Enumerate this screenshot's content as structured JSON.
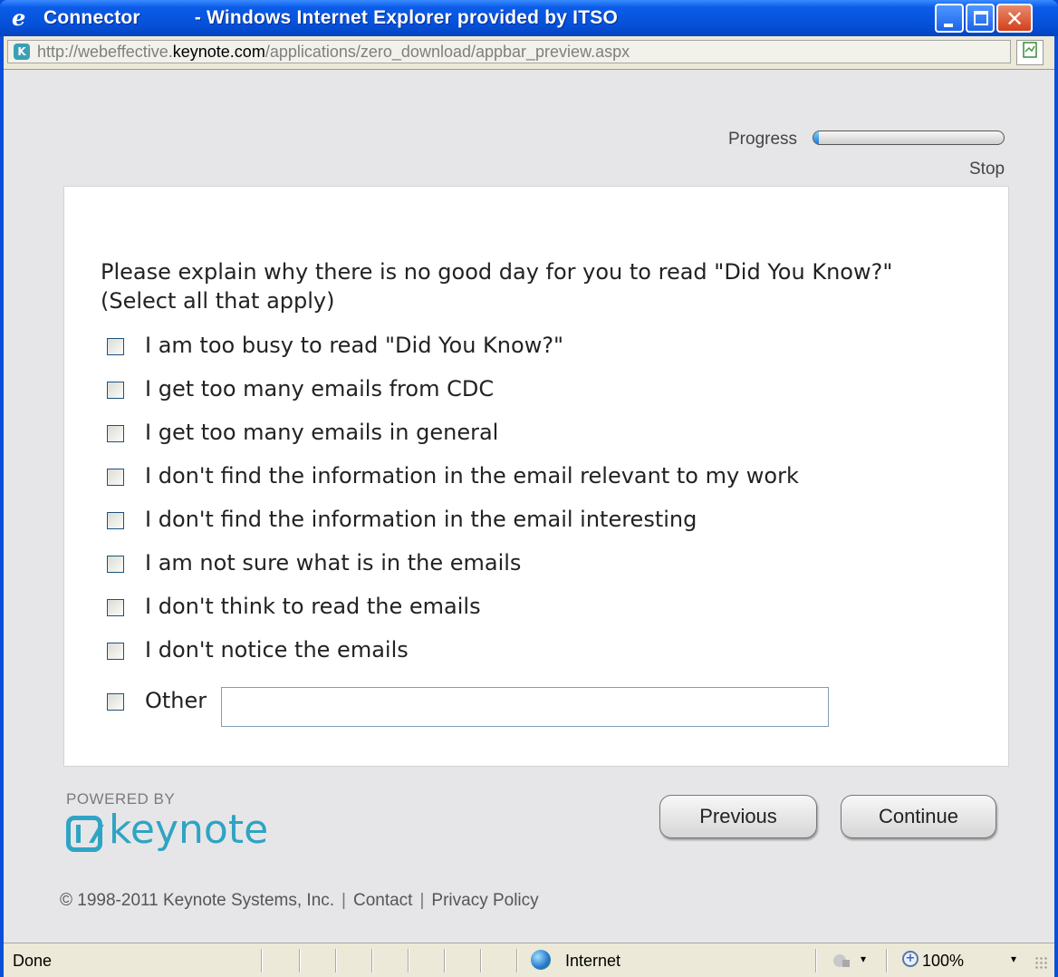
{
  "window": {
    "app_name": "Connector",
    "title_rest": "- Windows Internet Explorer provided by ITSO",
    "ie_icon": "ie-logo-icon",
    "minimize_icon": "minimize-icon",
    "maximize_icon": "maximize-icon",
    "close_icon": "close-icon",
    "close_glyph": "✕"
  },
  "address_bar": {
    "url_prefix": "http://webeffective.",
    "url_host": "keynote.com",
    "url_path": "/applications/zero_download/appbar_preview.aspx",
    "site_icon": "keynote-site-icon",
    "site_glyph": "K"
  },
  "survey": {
    "progress_label": "Progress",
    "progress_fraction": 0.03,
    "stop_label": "Stop",
    "question": "Please explain why there is no good day for you to read \"Did You Know?\" (Select all that apply)",
    "options": [
      {
        "label": "I am too busy to read \"Did You Know?\"",
        "checked": false
      },
      {
        "label": "I get too many emails from CDC",
        "checked": false
      },
      {
        "label": "I get too many emails in general",
        "checked": false
      },
      {
        "label": "I don't find the information in the email relevant to my work",
        "checked": false
      },
      {
        "label": "I don't find the information in the email interesting",
        "checked": false
      },
      {
        "label": "I am not sure what is in the emails",
        "checked": false
      },
      {
        "label": "I don't think to read the emails",
        "checked": false
      },
      {
        "label": "I don't notice the emails",
        "checked": false
      }
    ],
    "other": {
      "label": "Other",
      "value": "",
      "checked": false
    },
    "previous_label": "Previous",
    "continue_label": "Continue"
  },
  "branding": {
    "powered_by": "POWERED BY",
    "logo_text": "keynote",
    "brand_color": "#2fa4c3"
  },
  "footer": {
    "copyright": "© 1998-2011 Keynote Systems, Inc.",
    "separator": "|",
    "contact": "Contact",
    "privacy": "Privacy Policy"
  },
  "status_bar": {
    "status": "Done",
    "zone": "Internet",
    "zoom": "100%",
    "arrow": "▾",
    "zoom_glyph": "+"
  }
}
